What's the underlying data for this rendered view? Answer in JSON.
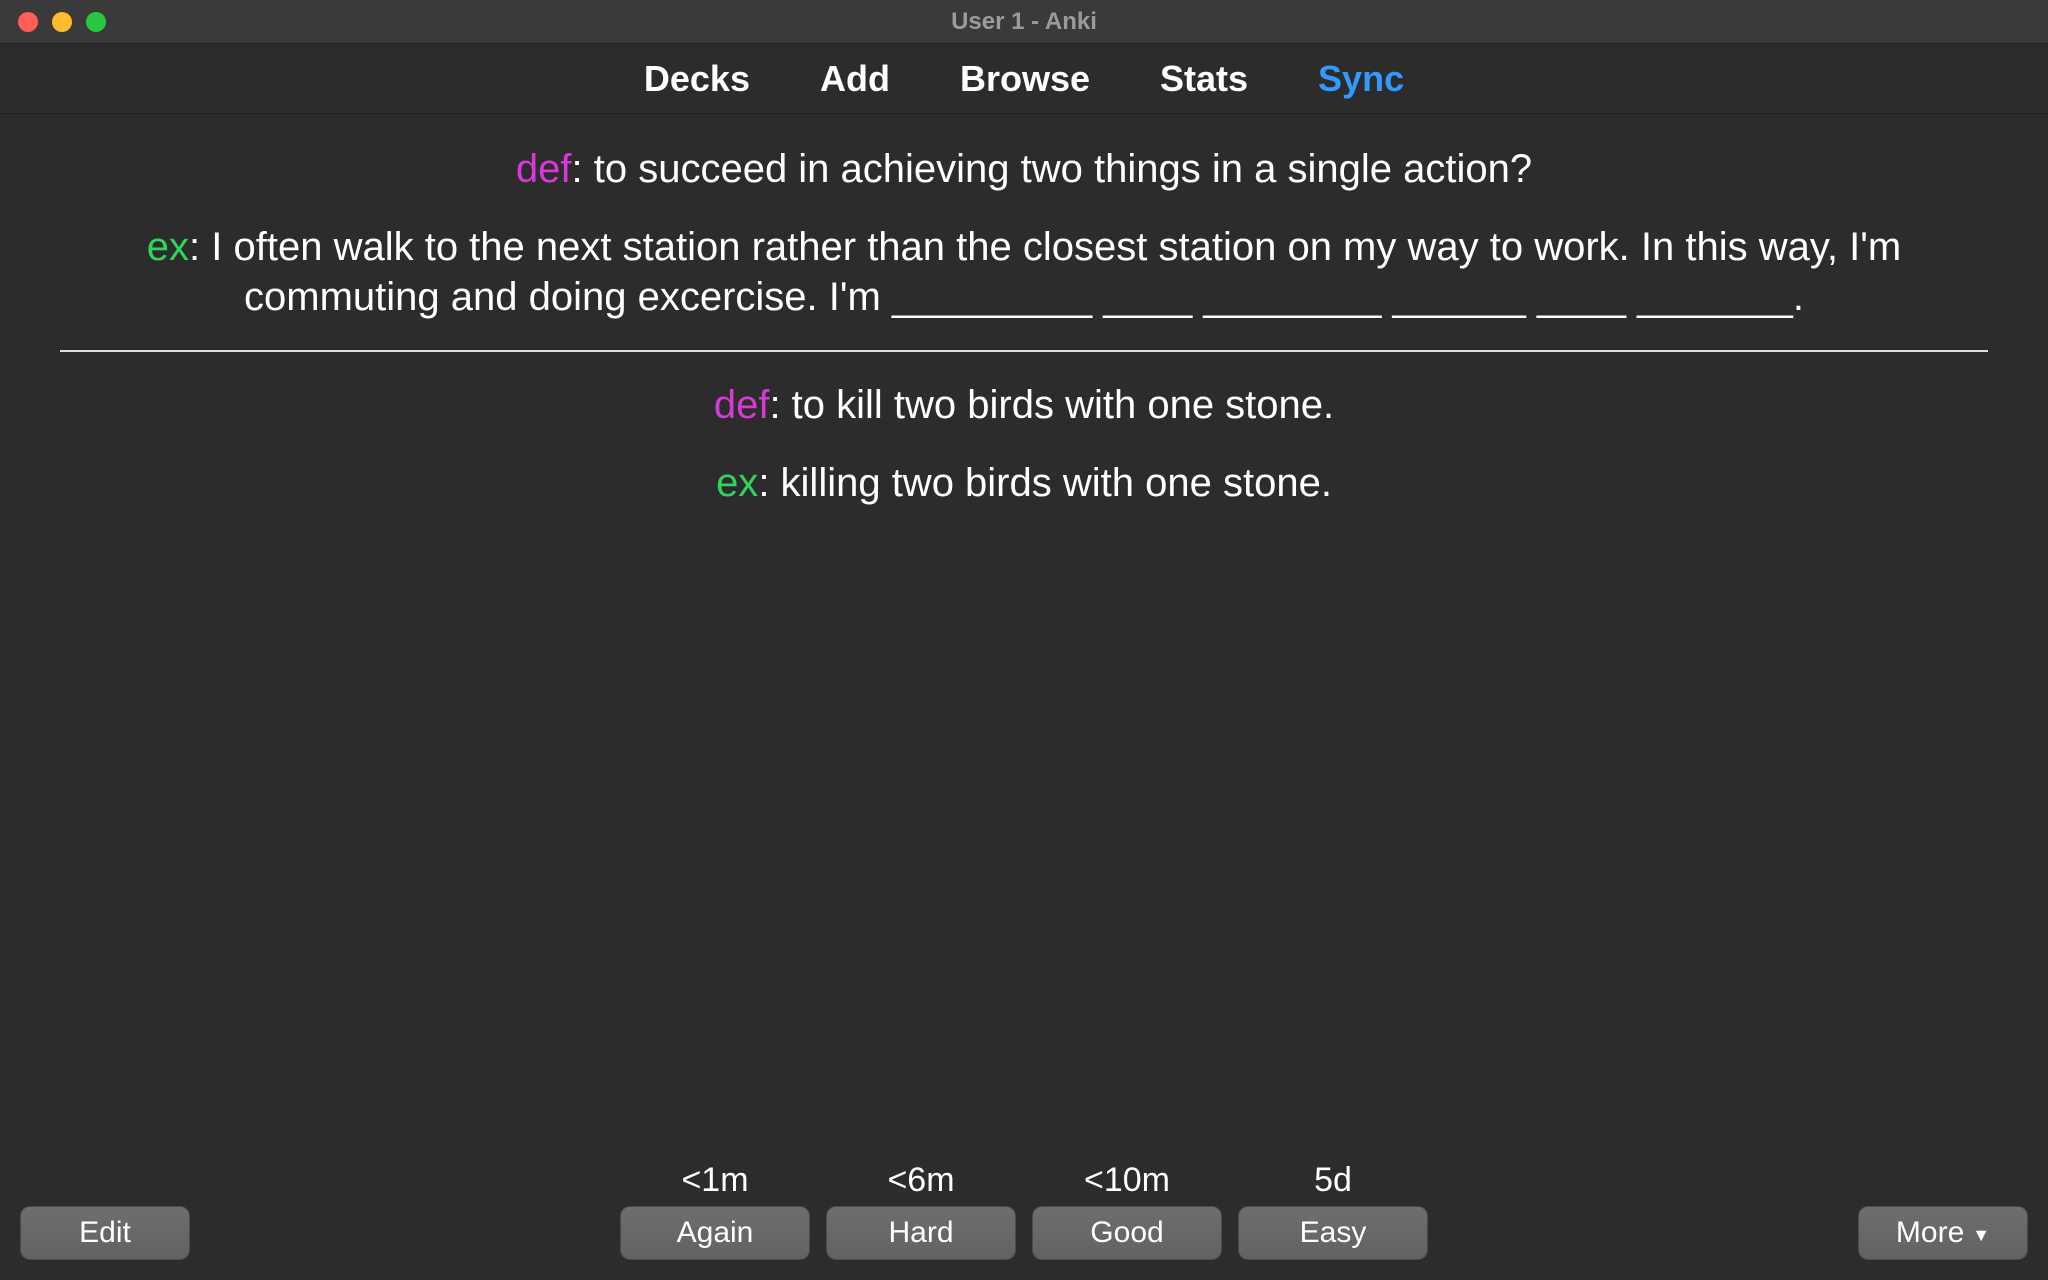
{
  "window": {
    "title": "User 1 - Anki"
  },
  "nav": {
    "decks": "Decks",
    "add": "Add",
    "browse": "Browse",
    "stats": "Stats",
    "sync": "Sync"
  },
  "card": {
    "front": {
      "def_label": "def",
      "def_text": ": to succeed in achieving two things in a single action?",
      "ex_label": "ex",
      "ex_text": ": I often walk to the next station rather than the closest station on my way to work. In this way, I'm commuting and doing excercise. I'm _________ ____ ________ ______ ____ _______."
    },
    "back": {
      "def_label": "def",
      "def_text": ": to kill two birds with one stone.",
      "ex_label": "ex",
      "ex_text": ": killing two birds with one stone."
    }
  },
  "answers": {
    "again": {
      "interval": "<1m",
      "label": "Again"
    },
    "hard": {
      "interval": "<6m",
      "label": "Hard"
    },
    "good": {
      "interval": "<10m",
      "label": "Good"
    },
    "easy": {
      "interval": "5d",
      "label": "Easy"
    }
  },
  "footer": {
    "edit": "Edit",
    "more": "More"
  }
}
